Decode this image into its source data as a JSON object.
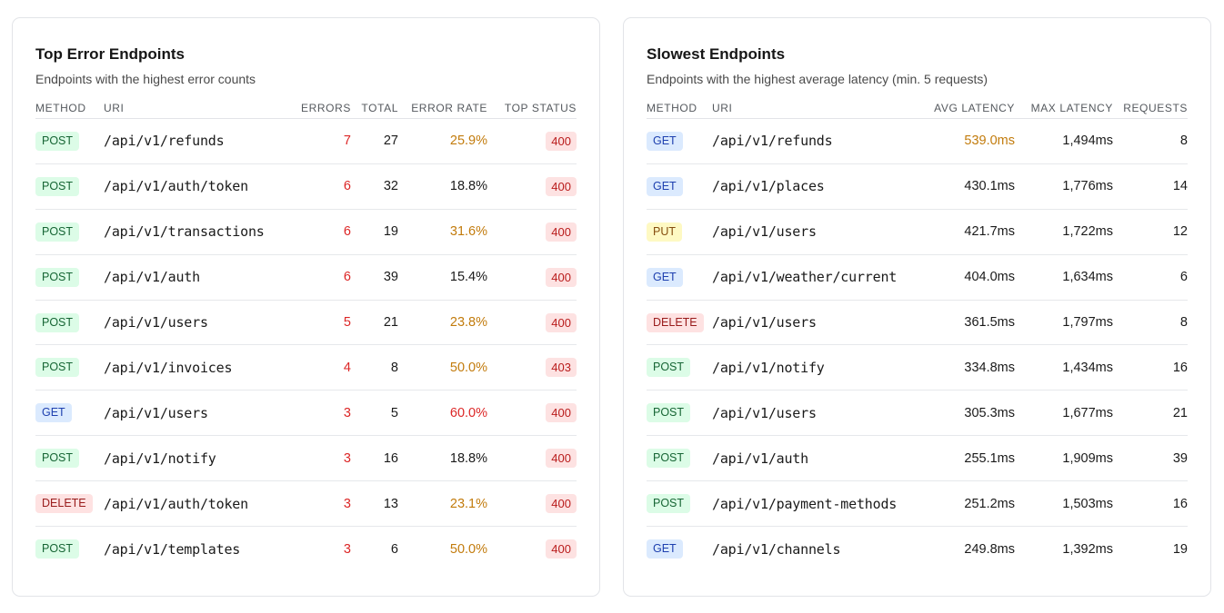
{
  "errors_panel": {
    "title": "Top Error Endpoints",
    "subtitle": "Endpoints with the highest error counts",
    "columns": {
      "method": "METHOD",
      "uri": "URI",
      "errors": "ERRORS",
      "total": "TOTAL",
      "error_rate": "ERROR RATE",
      "top_status": "TOP STATUS"
    },
    "rows": [
      {
        "method": "POST",
        "uri": "/api/v1/refunds",
        "errors": "7",
        "total": "27",
        "error_rate": "25.9%",
        "rate_level": "amber",
        "top_status": "400"
      },
      {
        "method": "POST",
        "uri": "/api/v1/auth/token",
        "errors": "6",
        "total": "32",
        "error_rate": "18.8%",
        "rate_level": "dark",
        "top_status": "400"
      },
      {
        "method": "POST",
        "uri": "/api/v1/transactions",
        "errors": "6",
        "total": "19",
        "error_rate": "31.6%",
        "rate_level": "amber",
        "top_status": "400"
      },
      {
        "method": "POST",
        "uri": "/api/v1/auth",
        "errors": "6",
        "total": "39",
        "error_rate": "15.4%",
        "rate_level": "dark",
        "top_status": "400"
      },
      {
        "method": "POST",
        "uri": "/api/v1/users",
        "errors": "5",
        "total": "21",
        "error_rate": "23.8%",
        "rate_level": "amber",
        "top_status": "400"
      },
      {
        "method": "POST",
        "uri": "/api/v1/invoices",
        "errors": "4",
        "total": "8",
        "error_rate": "50.0%",
        "rate_level": "amber",
        "top_status": "403"
      },
      {
        "method": "GET",
        "uri": "/api/v1/users",
        "errors": "3",
        "total": "5",
        "error_rate": "60.0%",
        "rate_level": "red",
        "top_status": "400"
      },
      {
        "method": "POST",
        "uri": "/api/v1/notify",
        "errors": "3",
        "total": "16",
        "error_rate": "18.8%",
        "rate_level": "dark",
        "top_status": "400"
      },
      {
        "method": "DELETE",
        "uri": "/api/v1/auth/token",
        "errors": "3",
        "total": "13",
        "error_rate": "23.1%",
        "rate_level": "amber",
        "top_status": "400"
      },
      {
        "method": "POST",
        "uri": "/api/v1/templates",
        "errors": "3",
        "total": "6",
        "error_rate": "50.0%",
        "rate_level": "amber",
        "top_status": "400"
      }
    ]
  },
  "latency_panel": {
    "title": "Slowest Endpoints",
    "subtitle": "Endpoints with the highest average latency (min. 5 requests)",
    "columns": {
      "method": "METHOD",
      "uri": "URI",
      "avg_latency": "AVG LATENCY",
      "max_latency": "MAX LATENCY",
      "requests": "REQUESTS"
    },
    "rows": [
      {
        "method": "GET",
        "uri": "/api/v1/refunds",
        "avg_latency": "539.0ms",
        "avg_level": "amber",
        "max_latency": "1,494ms",
        "requests": "8"
      },
      {
        "method": "GET",
        "uri": "/api/v1/places",
        "avg_latency": "430.1ms",
        "avg_level": "dark",
        "max_latency": "1,776ms",
        "requests": "14"
      },
      {
        "method": "PUT",
        "uri": "/api/v1/users",
        "avg_latency": "421.7ms",
        "avg_level": "dark",
        "max_latency": "1,722ms",
        "requests": "12"
      },
      {
        "method": "GET",
        "uri": "/api/v1/weather/current",
        "avg_latency": "404.0ms",
        "avg_level": "dark",
        "max_latency": "1,634ms",
        "requests": "6"
      },
      {
        "method": "DELETE",
        "uri": "/api/v1/users",
        "avg_latency": "361.5ms",
        "avg_level": "dark",
        "max_latency": "1,797ms",
        "requests": "8"
      },
      {
        "method": "POST",
        "uri": "/api/v1/notify",
        "avg_latency": "334.8ms",
        "avg_level": "dark",
        "max_latency": "1,434ms",
        "requests": "16"
      },
      {
        "method": "POST",
        "uri": "/api/v1/users",
        "avg_latency": "305.3ms",
        "avg_level": "dark",
        "max_latency": "1,677ms",
        "requests": "21"
      },
      {
        "method": "POST",
        "uri": "/api/v1/auth",
        "avg_latency": "255.1ms",
        "avg_level": "dark",
        "max_latency": "1,909ms",
        "requests": "39"
      },
      {
        "method": "POST",
        "uri": "/api/v1/payment-methods",
        "avg_latency": "251.2ms",
        "avg_level": "dark",
        "max_latency": "1,503ms",
        "requests": "16"
      },
      {
        "method": "GET",
        "uri": "/api/v1/channels",
        "avg_latency": "249.8ms",
        "avg_level": "dark",
        "max_latency": "1,392ms",
        "requests": "19"
      }
    ]
  },
  "colors": {
    "method_post": "#dcfce7",
    "method_get": "#dbeafe",
    "method_put": "#fef9c3",
    "method_delete": "#fee2e2",
    "error_red": "#dc2626",
    "warn_amber": "#c27b0c",
    "status_badge_bg": "#fde2e2"
  }
}
